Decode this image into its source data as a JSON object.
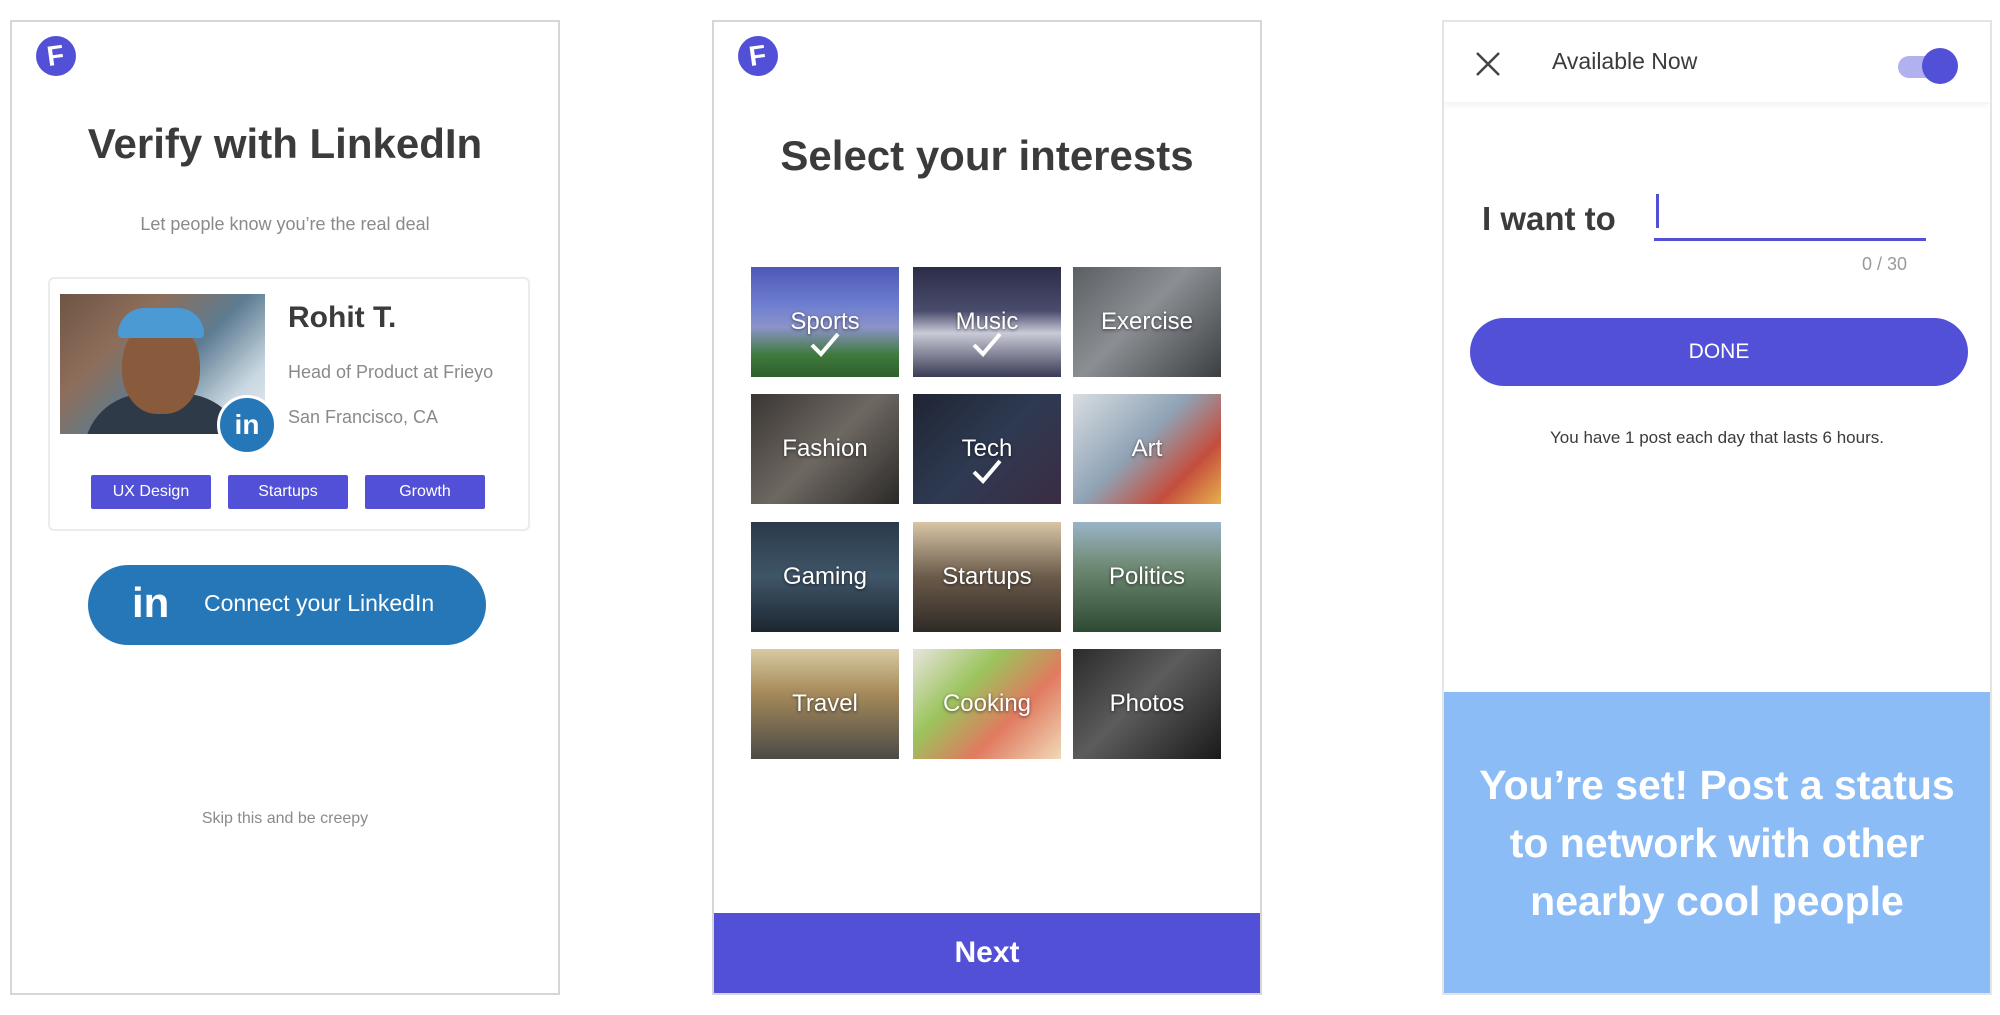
{
  "brand": {
    "logo_letter": "F",
    "accent": "#5150d6",
    "linkedin_blue": "#2677b8",
    "panel_blue": "#8bbcf6"
  },
  "screen1": {
    "title": "Verify with LinkedIn",
    "subtitle": "Let people know you’re the real deal",
    "profile": {
      "name": "Rohit T.",
      "role": "Head of Product at Frieyo",
      "location": "San Francisco, CA",
      "badge_icon": "linkedin-icon",
      "badge_text": "in",
      "tags": [
        "UX Design",
        "Startups",
        "Growth"
      ]
    },
    "connect_button": {
      "icon": "linkedin-icon",
      "icon_text": "in",
      "label": "Connect your LinkedIn"
    },
    "skip_link": "Skip this and be creepy"
  },
  "screen2": {
    "title": "Select your interests",
    "interests": [
      {
        "label": "Sports",
        "selected": true
      },
      {
        "label": "Music",
        "selected": true
      },
      {
        "label": "Exercise",
        "selected": false
      },
      {
        "label": "Fashion",
        "selected": false
      },
      {
        "label": "Tech",
        "selected": true
      },
      {
        "label": "Art",
        "selected": false
      },
      {
        "label": "Gaming",
        "selected": false
      },
      {
        "label": "Startups",
        "selected": false
      },
      {
        "label": "Politics",
        "selected": false
      },
      {
        "label": "Travel",
        "selected": false
      },
      {
        "label": "Cooking",
        "selected": false
      },
      {
        "label": "Photos",
        "selected": false
      }
    ],
    "next_label": "Next"
  },
  "screen3": {
    "close_icon": "close-icon",
    "availability_label": "Available Now",
    "availability_on": true,
    "prompt_label": "I want to",
    "input_value": "",
    "char_counter": "0 / 30",
    "done_label": "DONE",
    "post_note": "You have 1 post each day that lasts 6 hours.",
    "message_lines": [
      "You’re set! Post a status",
      "to network with other",
      "nearby cool people"
    ]
  }
}
